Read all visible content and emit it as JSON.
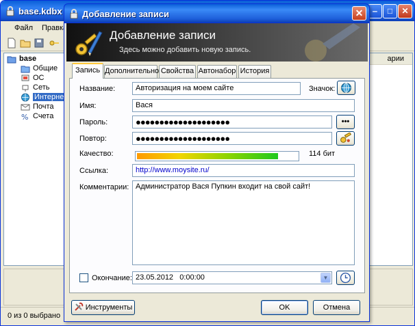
{
  "main_window": {
    "title": "base.kdbx -",
    "menu": [
      "Файл",
      "Правка"
    ],
    "tree": {
      "root": "base",
      "items": [
        "Общие",
        "ОС",
        "Сеть",
        "Интернет",
        "Почта",
        "Счета"
      ],
      "selected": "Интернет"
    },
    "list_header_partial": "арии",
    "status": "0 из 0 выбрано"
  },
  "dialog": {
    "title": "Добавление записи",
    "close_symbol": "✕",
    "banner": {
      "title": "Добавление записи",
      "subtitle": "Здесь можно добавить новую запись."
    },
    "tabs": [
      "Запись",
      "Дополнительно",
      "Свойства",
      "Автонабор",
      "История"
    ],
    "active_tab": "Запись",
    "fields": {
      "title_label": "Название:",
      "title_value": "Авторизация на моем сайте",
      "icon_label": "Значок:",
      "username_label": "Имя:",
      "username_value": "Вася",
      "password_label": "Пароль:",
      "password_value": "●●●●●●●●●●●●●●●●●●●●",
      "repeat_label": "Повтор:",
      "repeat_value": "●●●●●●●●●●●●●●●●●●●●",
      "reveal_button": "•••",
      "quality_label": "Качество:",
      "quality_text": "114 бит",
      "quality_fraction": 0.88,
      "url_label": "Ссылка:",
      "url_value": "http://www.moysite.ru/",
      "notes_label": "Комментарии:",
      "notes_value": "Администратор Вася Пупкин входит на свой сайт!",
      "expiry_label": "Окончание:",
      "expiry_value": "23.05.2012   0:00:00",
      "expiry_checked": false
    },
    "buttons": {
      "tools": "Инструменты",
      "ok": "OK",
      "cancel": "Отмена"
    }
  },
  "colors": {
    "titlebar_blue": "#0a5fd8",
    "dialog_face": "#ece9d8",
    "link_blue": "#0000cc",
    "selection_blue": "#316ac5",
    "tab_highlight": "#ffc83c"
  }
}
